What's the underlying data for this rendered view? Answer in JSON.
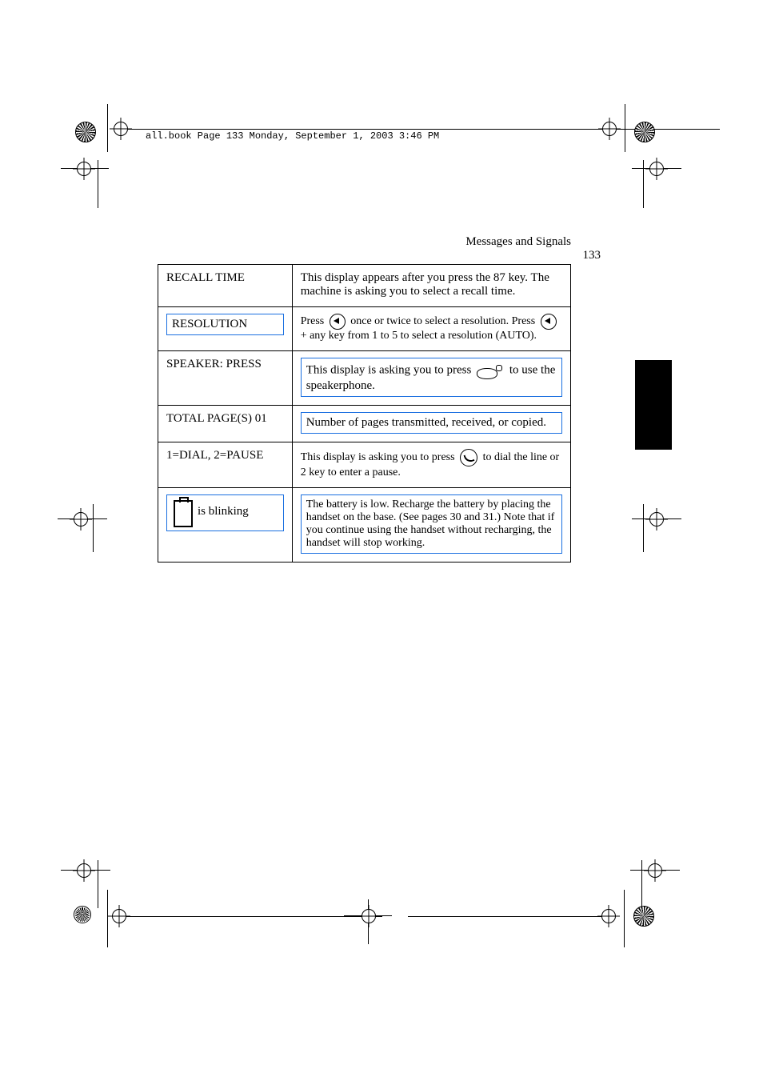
{
  "header_line": "all.book  Page 133  Monday, September 1, 2003  3:46 PM",
  "running_head": "Messages and Signals",
  "page_number": "133",
  "rows": [
    {
      "c1": "RECALL TIME",
      "c2": "This display appears after you press the 87 key. The machine is asking you to select a recall time."
    },
    {
      "c1": "RESOLUTION",
      "c2_a": "Press ",
      "c2_b": " once or twice to select a resolution. Press ",
      "c2_c": " + any key from 1 to 5 to select a resolution (AUTO)."
    },
    {
      "c1": "SPEAKER: PRESS",
      "c2_a": "This display is asking you to press ",
      "c2_b": " to use the speakerphone."
    },
    {
      "c1": "TOTAL PAGE(S) 01",
      "c2": "Number of pages transmitted, received, or copied."
    },
    {
      "c1": "1=DIAL, 2=PAUSE",
      "c2_a": "This display is asking you to press ",
      "c2_b": " to dial the line or 2 key to enter a pause."
    },
    {
      "c1_icon": "battery",
      "c1_text": " is blinking",
      "c2": "The battery is low. Recharge the battery by placing the handset on the base. (See pages 30 and 31.) Note that if you continue using the handset without recharging, the handset will stop working."
    }
  ]
}
